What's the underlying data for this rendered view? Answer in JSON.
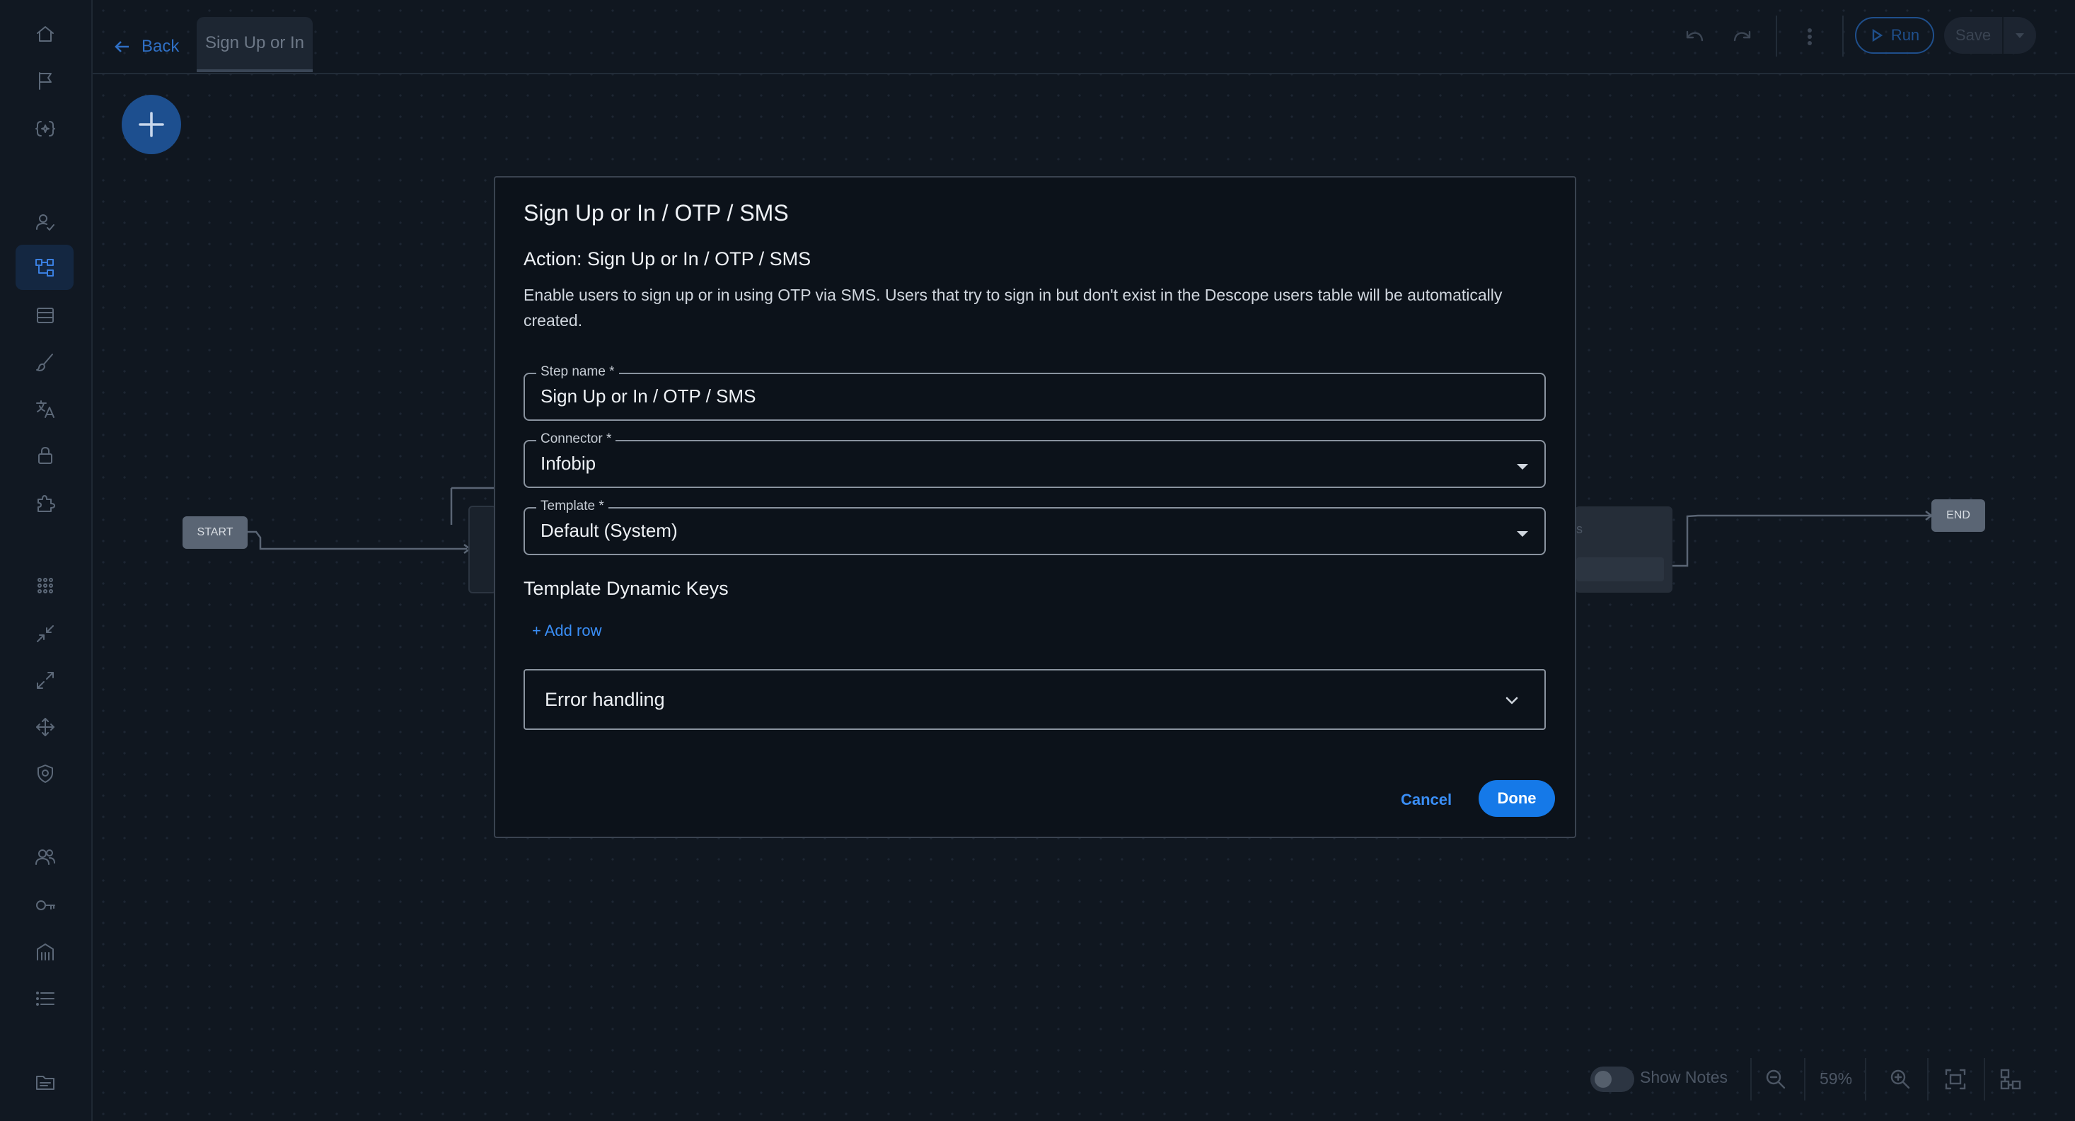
{
  "topbar": {
    "back_label": "Back",
    "tab_label": "Sign Up or In",
    "run_label": "Run",
    "save_label": "Save"
  },
  "flow": {
    "start_label": "START",
    "end_label": "END",
    "partial_text": "s"
  },
  "bottom": {
    "show_notes_label": "Show Notes",
    "show_notes_on": false,
    "zoom": "59%"
  },
  "modal": {
    "title": "Sign Up or In / OTP / SMS",
    "subtitle": "Action: Sign Up or In / OTP / SMS",
    "description": "Enable users to sign up or in using OTP via SMS. Users that try to sign in but don't exist in the Descope users table will be automatically created.",
    "step_name": {
      "label": "Step name *",
      "value": "Sign Up or In / OTP / SMS"
    },
    "connector": {
      "label": "Connector *",
      "value": "Infobip"
    },
    "template": {
      "label": "Template *",
      "value": "Default (System)"
    },
    "dynamic_keys_heading": "Template Dynamic Keys",
    "add_row_label": "+ Add row",
    "error_handling_label": "Error handling",
    "cancel_label": "Cancel",
    "done_label": "Done"
  },
  "colors": {
    "accent": "#1579e8",
    "link": "#3a8ef6",
    "background": "#101720",
    "modal_bg": "#0c121a"
  }
}
